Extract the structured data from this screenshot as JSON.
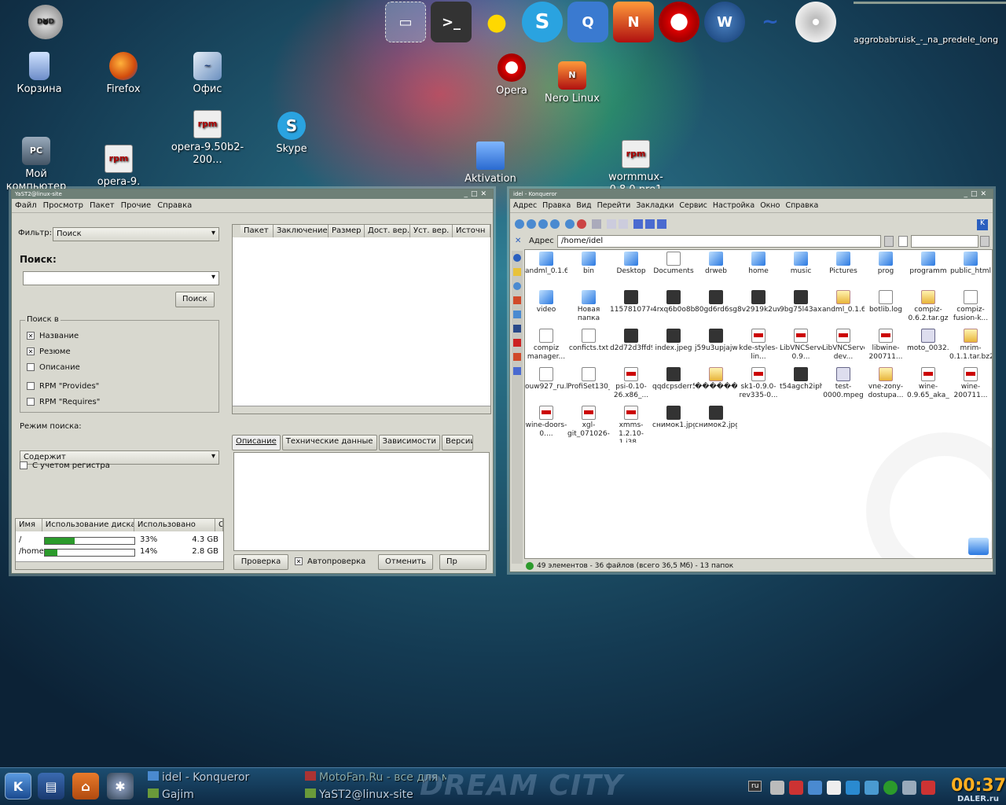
{
  "desktop": {
    "icons": [
      "Корзина",
      "Firefox",
      "Офис",
      "Opera",
      "Nero Linux",
      "opera-9.50b2-200...",
      "Skype",
      "Мой компьютер",
      "opera-9.",
      "Aktivation",
      "wormmux-0.8.0.pre1"
    ],
    "dvd_label": "DVD",
    "top_right_label": "aggrobabruisk_-_na_predele_long",
    "launcher": [
      "monitor",
      "terminal",
      "bulb",
      "skype",
      "kopete",
      "nero",
      "opera",
      "wolf",
      "office",
      "cd"
    ]
  },
  "yast": {
    "title": "YaST2@linux-site",
    "menu": [
      "Файл",
      "Просмотр",
      "Пакет",
      "Прочие",
      "Справка"
    ],
    "filter_label": "Фильтр:",
    "filter_value": "Поиск",
    "search_label": "Поиск:",
    "search_button": "Поиск",
    "search_in_label": "Поиск в",
    "options": [
      {
        "label": "Название",
        "checked": true
      },
      {
        "label": "Резюме",
        "checked": true
      },
      {
        "label": "Описание",
        "checked": false
      },
      {
        "label": "RPM \"Provides\"",
        "checked": false
      },
      {
        "label": "RPM \"Requires\"",
        "checked": false
      }
    ],
    "mode_label": "Режим поиска:",
    "mode_value": "Содержит",
    "case_label": "С учетом регистра",
    "package_columns": [
      "Пакет",
      "Заключение",
      "Размер",
      "Дост. вер.",
      "Уст. вер.",
      "Источн"
    ],
    "tabs": [
      "Описание",
      "Технические данные",
      "Зависимости",
      "Версии"
    ],
    "disk_columns": [
      "Имя",
      "Использование диска",
      "Использовано",
      "С"
    ],
    "disk_rows": [
      {
        "name": "/",
        "percent": 33,
        "percent_label": "33%",
        "size": "4.3 GB"
      },
      {
        "name": "/home",
        "percent": 14,
        "percent_label": "14%",
        "size": "2.8 GB"
      }
    ],
    "bottom": {
      "check": "Проверка",
      "autocheck": "Автопроверка",
      "cancel": "Отменить",
      "apply": "Пр"
    }
  },
  "konq": {
    "title": "idel - Konqueror",
    "menu": [
      "Адрес",
      "Правка",
      "Вид",
      "Перейти",
      "Закладки",
      "Сервис",
      "Настройка",
      "Окно",
      "Справка"
    ],
    "address_label": "Адрес",
    "address_value": "/home/idel",
    "status": "49 элементов - 36 файлов (всего 36,5 Мб) - 13 папок",
    "files": [
      {
        "n": "andml_0.1.6",
        "t": "folder"
      },
      {
        "n": "bin",
        "t": "folder"
      },
      {
        "n": "Desktop",
        "t": "folder"
      },
      {
        "n": "Documents",
        "t": "txt"
      },
      {
        "n": "drweb",
        "t": "folder"
      },
      {
        "n": "home",
        "t": "folder"
      },
      {
        "n": "music",
        "t": "folder"
      },
      {
        "n": "Pictures",
        "t": "folder"
      },
      {
        "n": "prog",
        "t": "folder"
      },
      {
        "n": "programm",
        "t": "folder"
      },
      {
        "n": "public_html",
        "t": "folder"
      },
      {
        "n": "video",
        "t": "folder"
      },
      {
        "n": "Новая папка",
        "t": "folder"
      },
      {
        "n": "1157810774_linux...",
        "t": "img"
      },
      {
        "n": "4rxq6b0o8byc5l84r...",
        "t": "img"
      },
      {
        "n": "80gd6rd6sg9pncfr...",
        "t": "img"
      },
      {
        "n": "8v2919k2uw0fcm5...",
        "t": "img"
      },
      {
        "n": "9bg75l43axvroin3m...",
        "t": "img"
      },
      {
        "n": "andml_0.1.6.zip",
        "t": "arc"
      },
      {
        "n": "botlib.log",
        "t": "txt"
      },
      {
        "n": "compiz-0.6.2.tar.gz",
        "t": "arc"
      },
      {
        "n": "compiz-fusion-k...",
        "t": "txt"
      },
      {
        "n": "compiz manager...",
        "t": "txt"
      },
      {
        "n": "conficts.txt",
        "t": "txt"
      },
      {
        "n": "d2d72d3ffd9732bc...",
        "t": "img"
      },
      {
        "n": "index.jpeg",
        "t": "img"
      },
      {
        "n": "j59u3upjajwb0lsxj9x...",
        "t": "img"
      },
      {
        "n": "kde-styles-lin...",
        "t": "rpm"
      },
      {
        "n": "LibVNCServer-0.9...",
        "t": "rpm"
      },
      {
        "n": "LibVNCServer-dev...",
        "t": "rpm"
      },
      {
        "n": "libwine-200711...",
        "t": "rpm"
      },
      {
        "n": "moto_0032.3gp",
        "t": "vid"
      },
      {
        "n": "mrim-0.1.1.tar.bz2",
        "t": "arc"
      },
      {
        "n": "ouw927_ru.lng",
        "t": "txt"
      },
      {
        "n": "ProfiSet130_RUS...",
        "t": "txt"
      },
      {
        "n": "psi-0.10-26.x86_...",
        "t": "rpm"
      },
      {
        "n": "qqdcpsderr56dp8...",
        "t": "img"
      },
      {
        "n": "������...",
        "t": "arc"
      },
      {
        "n": "sk1-0.9.0-rev335-0...",
        "t": "rpm"
      },
      {
        "n": "t54agch2iphd37543...",
        "t": "img"
      },
      {
        "n": "test-0000.mpeg",
        "t": "vid"
      },
      {
        "n": "vne-zony-dostupa...",
        "t": "arc"
      },
      {
        "n": "wine-0.9.65_aka_...",
        "t": "rpm"
      },
      {
        "n": "wine-200711...",
        "t": "rpm"
      },
      {
        "n": "wine-doors-0....",
        "t": "rpm"
      },
      {
        "n": "xgl-git_071026-...",
        "t": "rpm"
      },
      {
        "n": "xmms-1.2.10-1.i38...",
        "t": "rpm"
      },
      {
        "n": "снимок1.jpg",
        "t": "img"
      },
      {
        "n": "снимок2.jpg",
        "t": "img"
      }
    ]
  },
  "taskbar": {
    "tasks": [
      "idel - Konqueror",
      "Gajim",
      "MotoFan.Ru - все для м...",
      "YaST2@linux-site"
    ],
    "brand": "DREAM CITY",
    "lang": "ru",
    "clock": "00:37",
    "watermark": "DALER.ru"
  },
  "colors": {
    "accent_green": "#2b9a2b",
    "clock": "#ffb020"
  }
}
